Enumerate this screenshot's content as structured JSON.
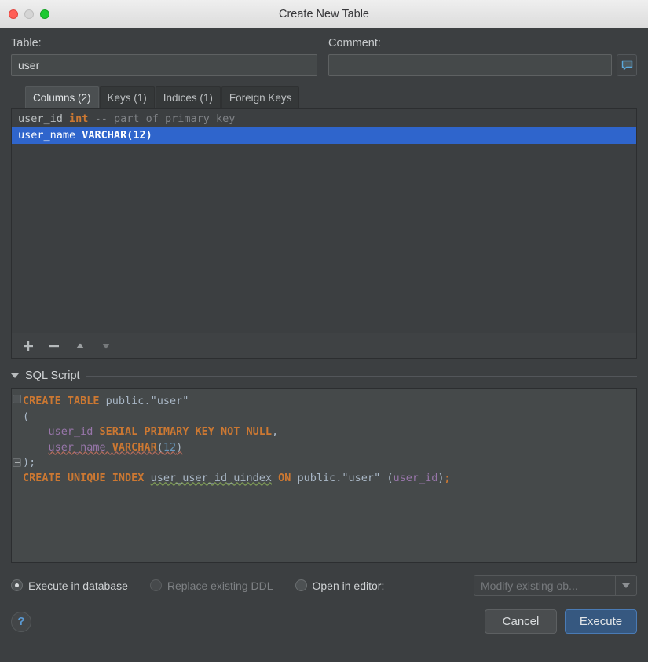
{
  "window": {
    "title": "Create New Table",
    "traffic_lights": [
      "close-red",
      "minimize-gray",
      "zoom-green"
    ]
  },
  "fields": {
    "table_label": "Table:",
    "table_value": "user",
    "table_placeholder": "",
    "comment_label": "Comment:",
    "comment_value": "",
    "comment_placeholder": "",
    "comment_icon": "speech-bubble-icon"
  },
  "tabs": [
    {
      "label": "Columns (2)",
      "active": true
    },
    {
      "label": "Keys (1)",
      "active": false
    },
    {
      "label": "Indices (1)",
      "active": false
    },
    {
      "label": "Foreign Keys",
      "active": false
    }
  ],
  "columns_list": {
    "rows": [
      {
        "name": "user_id",
        "type": "int",
        "comment": "-- part of primary key",
        "selected": false
      },
      {
        "name": "user_name",
        "type": "VARCHAR(12)",
        "comment": "",
        "selected": true
      }
    ],
    "toolbar": {
      "add": "+",
      "remove": "−",
      "move_up": "move-up",
      "move_down": "move-down"
    }
  },
  "sql_section": {
    "title": "SQL Script",
    "expanded": true,
    "lines": [
      [
        {
          "t": "CREATE TABLE ",
          "c": "kw"
        },
        {
          "t": "public.\"user\"",
          "c": "pl"
        }
      ],
      [
        {
          "t": "(",
          "c": "pl"
        }
      ],
      [
        {
          "t": "    ",
          "c": "pl"
        },
        {
          "t": "user_id ",
          "c": "id"
        },
        {
          "t": "SERIAL PRIMARY KEY NOT NULL",
          "c": "kw"
        },
        {
          "t": ",",
          "c": "pl"
        }
      ],
      [
        {
          "t": "    ",
          "c": "pl"
        },
        {
          "t": "user_name ",
          "c": "id sq"
        },
        {
          "t": "VARCHAR",
          "c": "kw sq"
        },
        {
          "t": "(",
          "c": "pl sq"
        },
        {
          "t": "12",
          "c": "num sq"
        },
        {
          "t": ")",
          "c": "pl sq"
        }
      ],
      [
        {
          "t": ");",
          "c": "pl"
        }
      ],
      [
        {
          "t": "CREATE UNIQUE INDEX ",
          "c": "kw"
        },
        {
          "t": "user_user_id_uindex",
          "c": "pl sqg"
        },
        {
          "t": " ",
          "c": "pl"
        },
        {
          "t": "ON ",
          "c": "kw"
        },
        {
          "t": "public.\"user\" (",
          "c": "pl"
        },
        {
          "t": "user_id",
          "c": "id"
        },
        {
          "t": ")",
          "c": "pl"
        },
        {
          "t": ";",
          "c": "kw"
        }
      ]
    ]
  },
  "options": {
    "execute_in_database": {
      "label": "Execute in database",
      "checked": true,
      "disabled": false
    },
    "replace_existing_ddl": {
      "label": "Replace existing DDL",
      "checked": false,
      "disabled": true
    },
    "open_in_editor": {
      "label": "Open in editor:",
      "checked": false,
      "disabled": false
    },
    "editor_select": {
      "value": "Modify existing ob...",
      "disabled": true
    }
  },
  "footer": {
    "help": "?",
    "cancel": "Cancel",
    "execute": "Execute"
  },
  "colors": {
    "accent_selection": "#2f65cc",
    "default_button": "#365880",
    "keyword": "#cc7832",
    "identifier": "#9876aa",
    "number": "#6897bb",
    "background": "#3c3f41"
  }
}
